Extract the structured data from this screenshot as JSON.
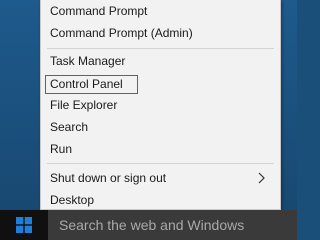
{
  "menu": {
    "items": [
      {
        "label": "Command Prompt"
      },
      {
        "label": "Command Prompt (Admin)"
      },
      {
        "label": "Task Manager"
      },
      {
        "label": "Control Panel"
      },
      {
        "label": "File Explorer"
      },
      {
        "label": "Search"
      },
      {
        "label": "Run"
      },
      {
        "label": "Shut down or sign out"
      },
      {
        "label": "Desktop"
      }
    ],
    "highlight_color": "#d9302c"
  },
  "taskbar": {
    "search_placeholder": "Search the web and Windows",
    "start_icon": "windows-logo-icon",
    "accent_color": "#1e7ed8"
  }
}
